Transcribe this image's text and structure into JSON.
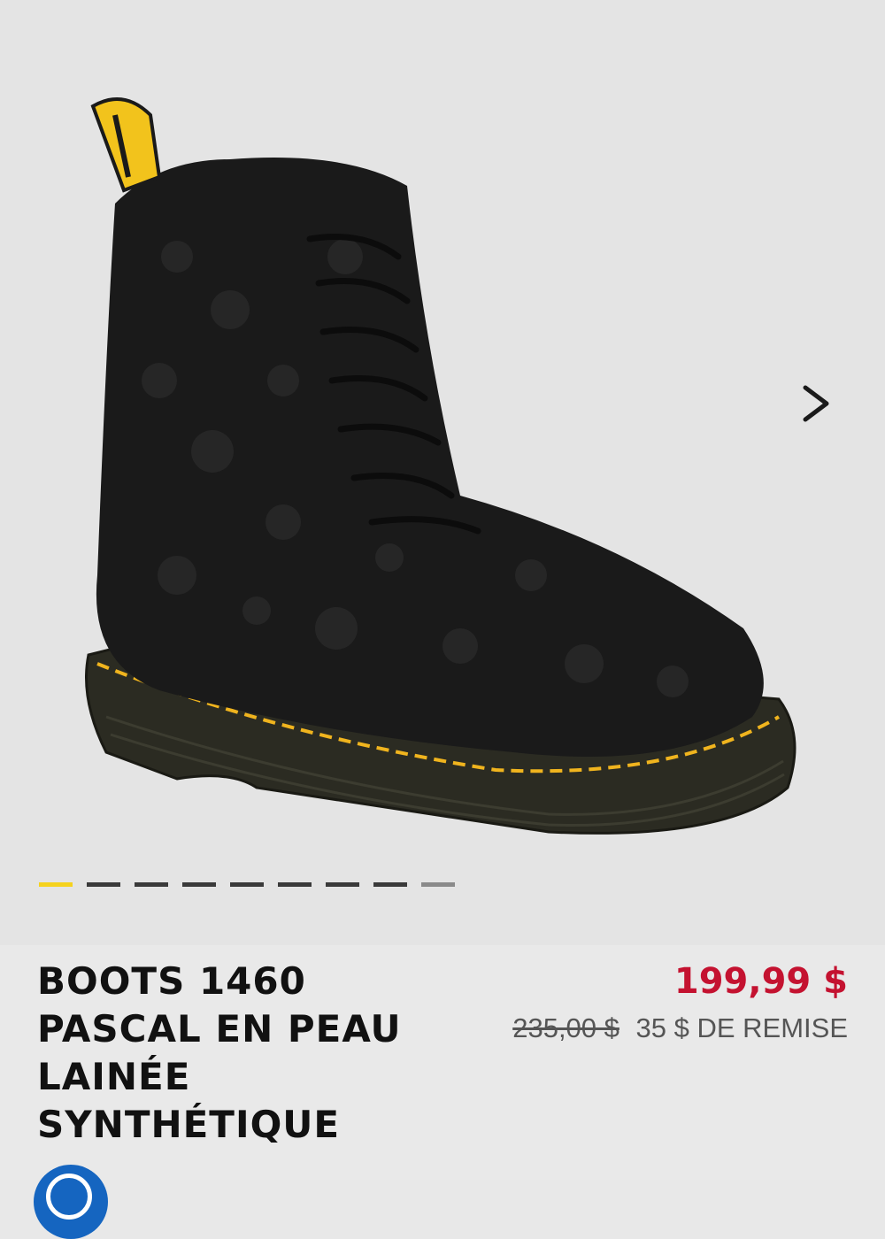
{
  "product": {
    "title": "BOOTS 1460 PASCAL EN PEAU LAINÉE SYNTHÉTIQUE",
    "sale_price": "199,99 $",
    "original_price": "235,00 $",
    "discount": "35 $ DE REMISE"
  },
  "gallery": {
    "image_count": 9,
    "active_index": 0,
    "next_icon": "chevron-right-icon",
    "image_subject": "black-boot-icon"
  },
  "colors": {
    "sale_price": "#c41230",
    "pager_active": "#f5d21e",
    "pager_inactive": "#3a3a3a"
  }
}
